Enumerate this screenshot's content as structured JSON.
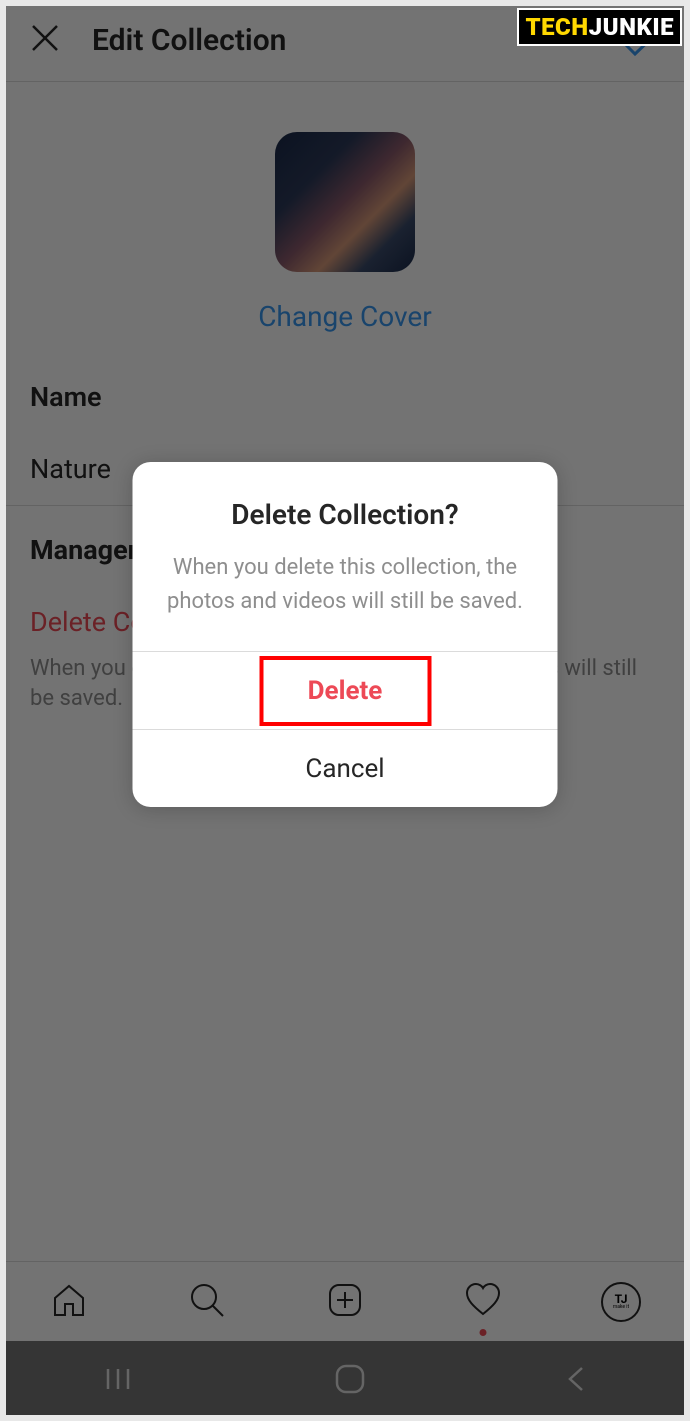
{
  "watermark": {
    "part1": "TECH",
    "part2": "JUNKIE"
  },
  "header": {
    "title": "Edit Collection"
  },
  "cover": {
    "change_label": "Change Cover"
  },
  "form": {
    "name_label": "Name",
    "name_value": "Nature"
  },
  "management": {
    "title": "Management",
    "delete_label": "Delete Collection",
    "delete_desc": "When you delete this collection, the photos and videos will still be saved."
  },
  "dialog": {
    "title": "Delete Collection?",
    "message": "When you delete this collection, the photos and videos will still be saved.",
    "delete_btn": "Delete",
    "cancel_btn": "Cancel"
  },
  "profile": {
    "initials": "TJ",
    "sub": "make it"
  }
}
